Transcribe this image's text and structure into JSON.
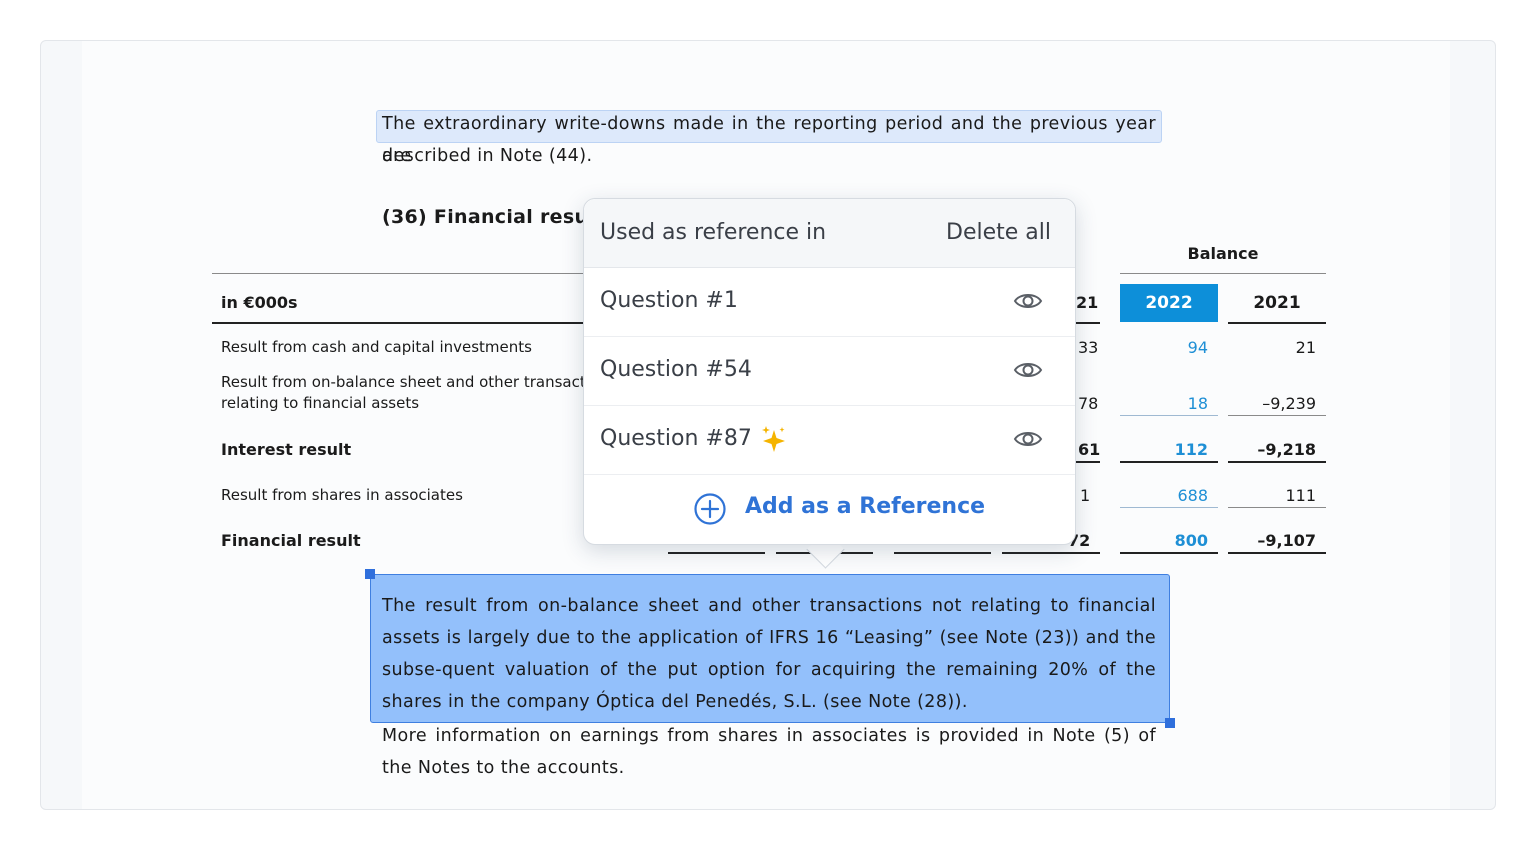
{
  "doc": {
    "para1_line1": "The extraordinary write-downs made in the reporting period and the previous year are",
    "para1_line2": "described in Note (44).",
    "section_title": "(36) Financial result",
    "balance_header": "Balance",
    "unit_label": "in €000s",
    "year_2022": "2022",
    "year_2021": "2021",
    "rows": [
      {
        "label": "Result from cash and capital investments",
        "frag": "33",
        "v2022": "94",
        "v2021": "21"
      },
      {
        "label_line1": "Result from on-balance sheet and other transacti",
        "label_line2": "relating to financial assets",
        "frag": "78",
        "v2022": "18",
        "v2021": "–9,239"
      },
      {
        "label": "Interest result",
        "frag": "61",
        "v2022": "112",
        "v2021": "–9,218"
      },
      {
        "label": "Result from shares in associates",
        "frag": "1",
        "v2022": "688",
        "v2021": "111"
      },
      {
        "label": "Financial result",
        "frag": "72",
        "v2022": "800",
        "v2021": "–9,107"
      }
    ],
    "header_frag": "21",
    "para2": "The result from on-balance sheet and other transactions not relating to financial assets is largely due to the application of IFRS 16 “Leasing” (see Note (23)) and the subse-quent valuation of the put option for acquiring the remaining 20% of the shares in the company Óptica del Penedés, S.L. (see Note (28)).",
    "para3": "More information on earnings from shares in associates is provided in Note (5) of the Notes to the accounts."
  },
  "popup": {
    "title": "Used as reference in",
    "delete_all": "Delete all",
    "items": [
      {
        "label": "Question #1",
        "ai": false
      },
      {
        "label": "Question #54",
        "ai": false
      },
      {
        "label": "Question #87",
        "ai": true
      }
    ],
    "add_label": "Add as a Reference"
  },
  "colors": {
    "accent_blue": "#0d8fd9",
    "selection_fill": "#93c0fb",
    "link_blue": "#2f73d6",
    "sparkle": "#f5b400"
  },
  "icons": [
    "eye-icon",
    "sparkle-icon",
    "plus-circle-icon"
  ]
}
